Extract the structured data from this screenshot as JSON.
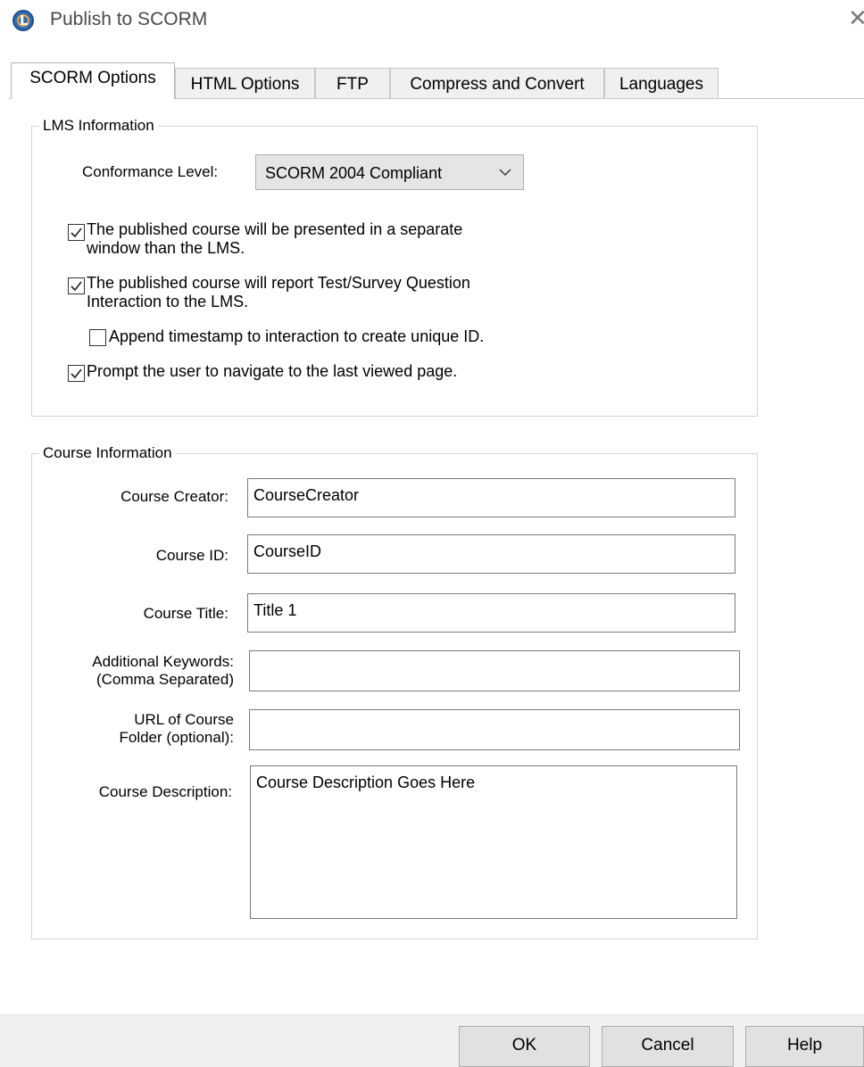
{
  "window": {
    "title": "Publish to SCORM",
    "icon": "lectora-logo-icon",
    "close_glyph": "✕"
  },
  "tabs": [
    {
      "label": "SCORM Options",
      "active": true
    },
    {
      "label": "HTML Options",
      "active": false
    },
    {
      "label": "FTP",
      "active": false
    },
    {
      "label": "Compress and Convert",
      "active": false
    },
    {
      "label": "Languages",
      "active": false
    }
  ],
  "lms": {
    "group_label": "LMS Information",
    "conformance_label": "Conformance Level:",
    "conformance_value": "SCORM 2004 Compliant",
    "checkboxes": [
      {
        "line1": "The published course will be presented in a separate",
        "line2": "window than the LMS.",
        "checked": true
      },
      {
        "line1": "The published course will report Test/Survey Question",
        "line2": "Interaction to the LMS.",
        "checked": true
      },
      {
        "line1": "Append timestamp to interaction to create unique ID.",
        "line2": "",
        "checked": false
      },
      {
        "line1": "Prompt the user to navigate to the last viewed page.",
        "line2": "",
        "checked": true
      }
    ]
  },
  "course": {
    "group_label": "Course Information",
    "creator_label": "Course Creator:",
    "creator_value": "CourseCreator",
    "id_label": "Course ID:",
    "id_value": "CourseID",
    "title_label": "Course Title:",
    "title_value": "Title 1",
    "keywords_label_1": "Additional Keywords:",
    "keywords_label_2": "(Comma Separated)",
    "keywords_value": "",
    "url_label_1": "URL of Course",
    "url_label_2": "Folder (optional):",
    "url_value": "",
    "description_label": "Course Description:",
    "description_value": "Course Description Goes Here"
  },
  "buttons": {
    "ok": "OK",
    "cancel": "Cancel",
    "help": "Help"
  }
}
